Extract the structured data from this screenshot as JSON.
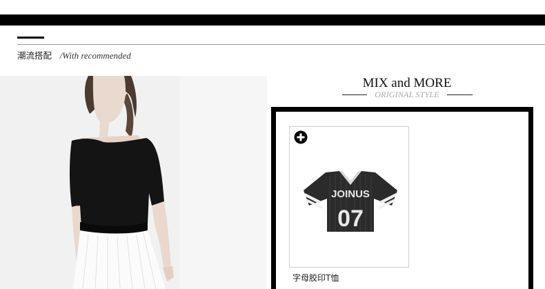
{
  "section": {
    "title_cn": "潮流搭配",
    "title_en": "/With recommended"
  },
  "mix": {
    "title": "MIX and MORE",
    "subtitle": "ORIGINAL STYLE"
  },
  "product": {
    "name": "字母胶印T恤",
    "print_text": "JOINUS",
    "number": "07",
    "add_icon": "plus-circle-icon"
  },
  "colors": {
    "bar": "#000000",
    "subtitle": "#a8a8a8",
    "card_border": "#cfcfcf"
  }
}
